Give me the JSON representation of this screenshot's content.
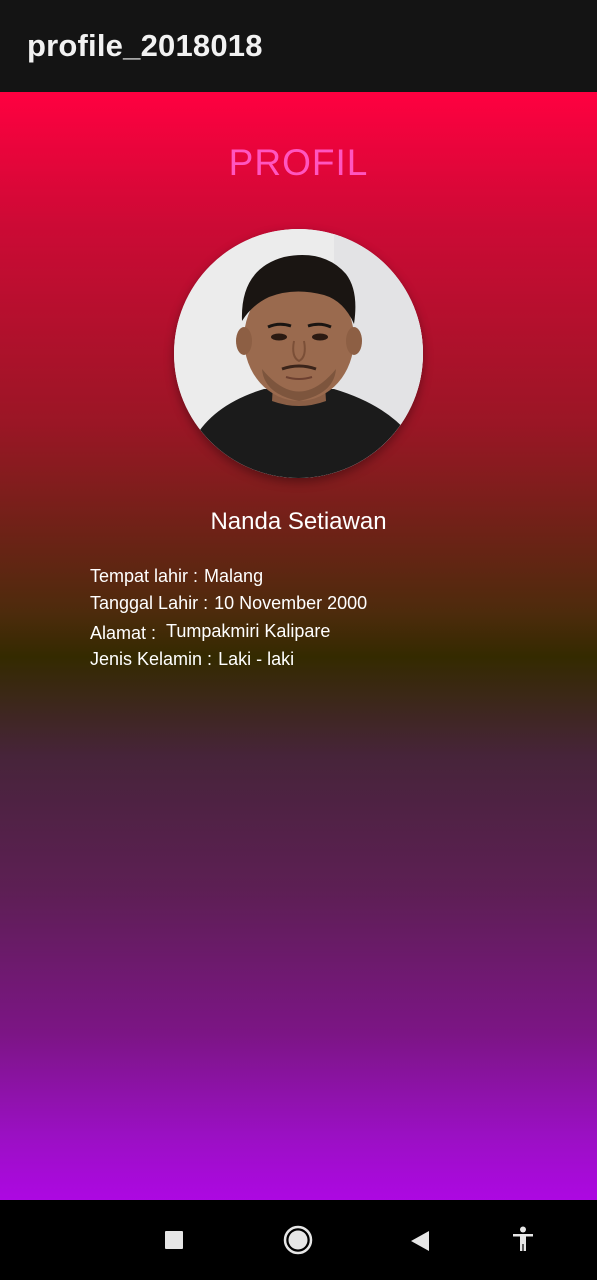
{
  "app_bar": {
    "title": "profile_2018018"
  },
  "profile": {
    "heading": "PROFIL",
    "name": "Nanda Setiawan",
    "photo_icon": "profile-photo",
    "details": [
      {
        "label": "Tempat lahir :",
        "value": "Malang"
      },
      {
        "label": "Tanggal Lahir :",
        "value": "10 November 2000"
      },
      {
        "label": "Alamat :",
        "value": "Tumpakmiri Kalipare"
      },
      {
        "label": "Jenis Kelamin :",
        "value": "Laki - laki"
      }
    ]
  },
  "colors": {
    "heading": "#ff55c0",
    "gradient_top": "#ff0040",
    "gradient_mid": "#342a00",
    "gradient_bottom": "#ad08e2"
  },
  "nav_bar": {
    "buttons": [
      "recent-apps-icon",
      "home-icon",
      "back-icon",
      "accessibility-icon"
    ]
  }
}
